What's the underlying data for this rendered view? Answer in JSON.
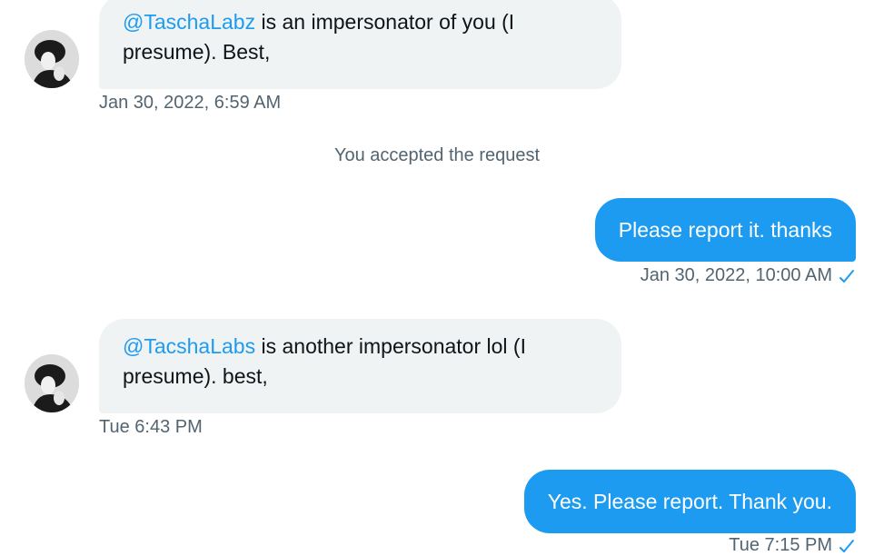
{
  "messages": [
    {
      "direction": "incoming",
      "mention": "@TaschaLabz",
      "text_line1": " is an impersonator of you (I",
      "text_line2": "presume).  Best,",
      "timestamp": "Jan 30, 2022, 6:59 AM"
    },
    {
      "direction": "outgoing",
      "text": "Please report it. thanks",
      "timestamp": "Jan 30, 2022, 10:00 AM",
      "status_icon": "check-icon"
    },
    {
      "direction": "incoming",
      "mention": "@TacshaLabs",
      "text_line1": " is another impersonator lol (I",
      "text_line2": "presume).  best,",
      "timestamp": "Tue 6:43 PM"
    },
    {
      "direction": "outgoing",
      "text": "Yes. Please report. Thank you.",
      "timestamp": "Tue 7:15 PM",
      "status_icon": "check-icon"
    }
  ],
  "system_message": "You accepted the request",
  "colors": {
    "accent": "#1d9bf0",
    "incoming_bubble": "#eff3f4",
    "muted_text": "#536471"
  }
}
